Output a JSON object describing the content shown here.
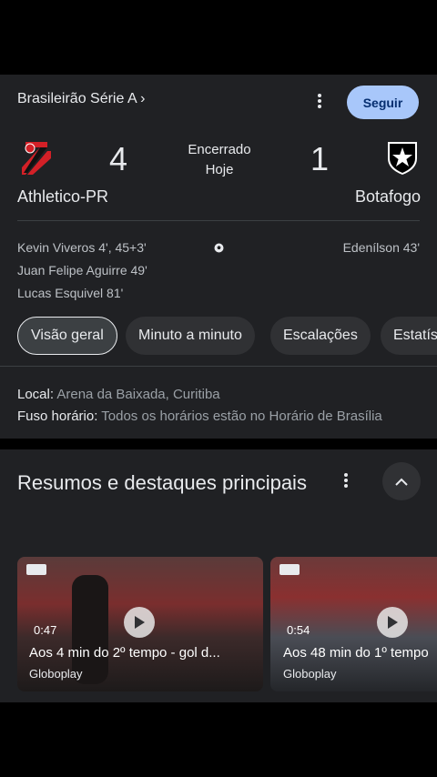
{
  "league": {
    "label": "Brasileirão Série A ›"
  },
  "follow_label": "Seguir",
  "match": {
    "home": {
      "name": "Athletico-PR",
      "score": "4",
      "logo": "athletico-shield-icon"
    },
    "away": {
      "name": "Botafogo",
      "score": "1",
      "logo": "botafogo-star-icon"
    },
    "status": "Encerrado",
    "date": "Hoje"
  },
  "scorers": {
    "home": [
      "Kevin Viveros 4', 45+3'",
      "Juan Felipe Aguirre 49'",
      "Lucas Esquivel 81'"
    ],
    "away": [
      "Edenílson 43'"
    ]
  },
  "tabs": [
    "Visão geral",
    "Minuto a minuto",
    "Escalações",
    "Estatís"
  ],
  "info": {
    "local_label": "Local:",
    "local_value": "Arena da Baixada, Curitiba",
    "tz_label": "Fuso horário:",
    "tz_value": "Todos os horários estão no Horário de Brasília"
  },
  "highlights": {
    "title": "Resumos e destaques principais",
    "videos": [
      {
        "duration": "0:47",
        "title": "Aos 4 min do 2º tempo - gol d...",
        "source": "Globoplay"
      },
      {
        "duration": "0:54",
        "title": "Aos 48 min do 1º tempo",
        "source": "Globoplay"
      }
    ]
  },
  "colors": {
    "accent": "#a8c7fa",
    "card_bg": "#202124",
    "muted": "#9aa0a6"
  }
}
